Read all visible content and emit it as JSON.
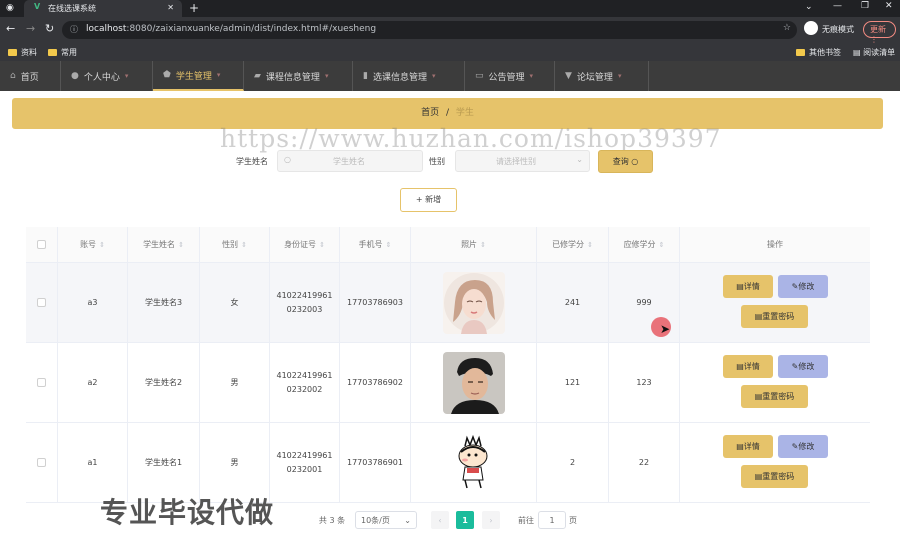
{
  "browser": {
    "tab_title": "在线选课系统",
    "url_host": "localhost",
    "url_rest": ":8080/zaixianxuanke/admin/dist/index.html#/xuesheng",
    "incognito_label": "无痕模式",
    "update_label": "更新",
    "bookmarks": [
      "资料",
      "常用"
    ],
    "bookmarks_right": [
      "其他书签",
      "阅读清单"
    ]
  },
  "nav": {
    "items": [
      {
        "label": "首页",
        "icon": "home-icon"
      },
      {
        "label": "个人中心",
        "icon": "user-icon"
      },
      {
        "label": "学生管理",
        "icon": "shield-icon",
        "active": true
      },
      {
        "label": "课程信息管理",
        "icon": "folder-icon"
      },
      {
        "label": "选课信息管理",
        "icon": "chart-icon"
      },
      {
        "label": "公告管理",
        "icon": "message-icon"
      },
      {
        "label": "论坛管理",
        "icon": "forum-icon"
      }
    ]
  },
  "breadcrumb": {
    "home": "首页",
    "sep": "/",
    "current": "学生"
  },
  "search": {
    "name_label": "学生姓名",
    "name_placeholder": "学生姓名",
    "gender_label": "性别",
    "gender_placeholder": "请选择性别",
    "query_label": "查询"
  },
  "add_label": "新增",
  "table": {
    "headers": [
      "账号",
      "学生姓名",
      "性别",
      "身份证号",
      "手机号",
      "照片",
      "已修学分",
      "应修学分",
      "操作"
    ],
    "rows": [
      {
        "account": "a3",
        "name": "学生姓名3",
        "gender": "女",
        "id_line1": "41022419961",
        "id_line2": "0232003",
        "phone": "17703786903",
        "earned": "241",
        "required": "999"
      },
      {
        "account": "a2",
        "name": "学生姓名2",
        "gender": "男",
        "id_line1": "41022419961",
        "id_line2": "0232002",
        "phone": "17703786902",
        "earned": "121",
        "required": "123"
      },
      {
        "account": "a1",
        "name": "学生姓名1",
        "gender": "男",
        "id_line1": "41022419961",
        "id_line2": "0232001",
        "phone": "17703786901",
        "earned": "2",
        "required": "22"
      }
    ],
    "actions": {
      "detail": "详情",
      "edit": "修改",
      "reset": "重置密码"
    }
  },
  "pagination": {
    "total": "共 3 条",
    "page_size": "10条/页",
    "current_page": "1",
    "goto_label": "前往",
    "goto_value": "1",
    "page_unit": "页"
  },
  "watermark": "https://www.huzhan.com/ishop39397",
  "ad_text": "专业毕设代做",
  "colors": {
    "accent": "#e6c36a",
    "edit_button": "#aab4e6",
    "nav_bg": "#3c3c3c"
  }
}
